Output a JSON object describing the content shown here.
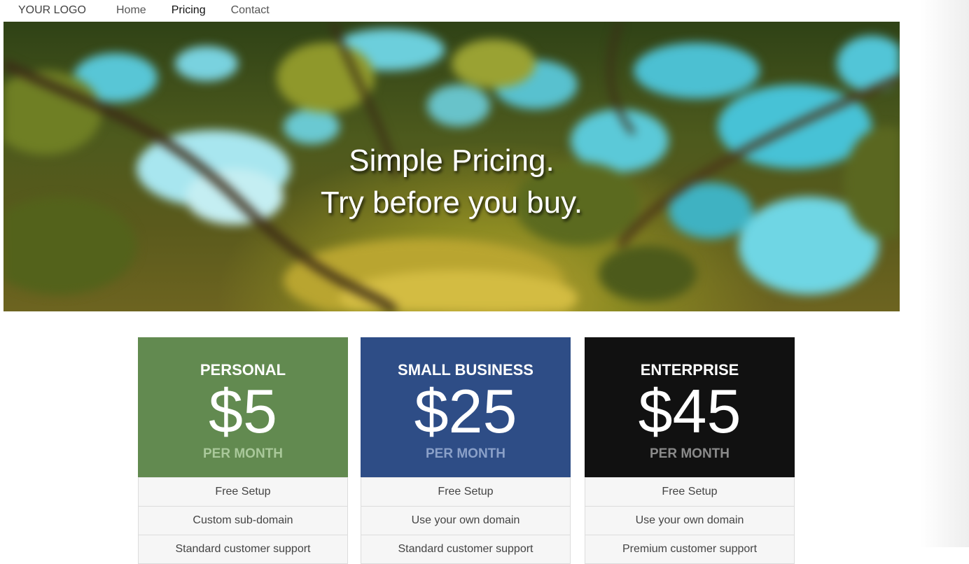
{
  "nav": {
    "logo": "YOUR LOGO",
    "links": [
      {
        "label": "Home",
        "active": false
      },
      {
        "label": "Pricing",
        "active": true
      },
      {
        "label": "Contact",
        "active": false
      }
    ]
  },
  "hero": {
    "line1": "Simple Pricing.",
    "line2": "Try before you buy."
  },
  "plans": [
    {
      "name": "PERSONAL",
      "price": "$5",
      "period": "PER MONTH",
      "color": "#628a50",
      "features": [
        "Free Setup",
        "Custom sub-domain",
        "Standard customer support"
      ]
    },
    {
      "name": "SMALL BUSINESS",
      "price": "$25",
      "period": "PER MONTH",
      "color": "#2e4d86",
      "features": [
        "Free Setup",
        "Use your own domain",
        "Standard customer support"
      ]
    },
    {
      "name": "ENTERPRISE",
      "price": "$45",
      "period": "PER MONTH",
      "color": "#111111",
      "features": [
        "Free Setup",
        "Use your own domain",
        "Premium customer support"
      ]
    }
  ]
}
